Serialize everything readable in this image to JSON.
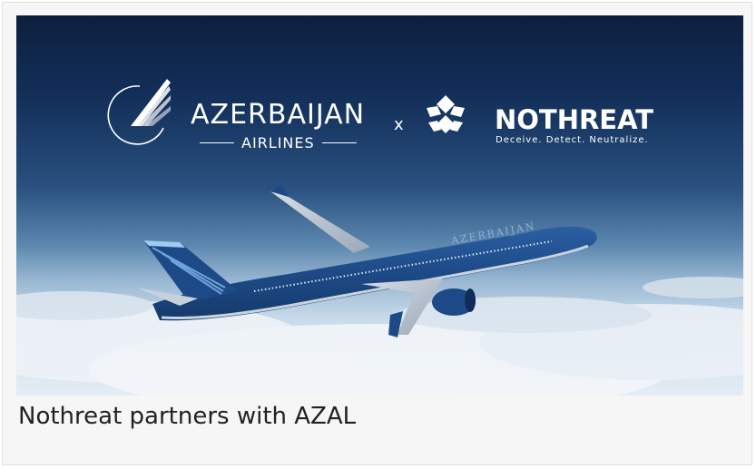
{
  "hero": {
    "partner_a": {
      "name": "AZERBAIJAN",
      "subname": "AIRLINES",
      "icon": "azal-wing-logo-icon"
    },
    "separator": "x",
    "partner_b": {
      "name": "NOTHREAT",
      "tagline": "Deceive. Detect. Neutralize.",
      "icon": "nothreat-snowflake-logo-icon"
    },
    "fuselage_text": "AZERBAIJAN"
  },
  "caption": "Nothreat partners with AZAL",
  "colors": {
    "sky_top": "#0c1f3d",
    "livery_blue": "#1d4a86",
    "caption_text": "#222222"
  }
}
